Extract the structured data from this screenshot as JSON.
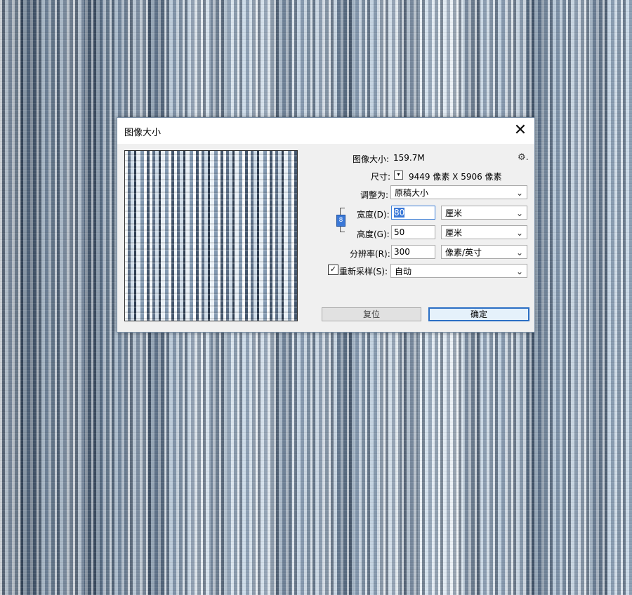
{
  "dialog": {
    "title": "图像大小",
    "close_glyph": "✕",
    "image_size_label": "图像大小:",
    "image_size_value": "159.7M",
    "gear_glyph": "⚙.",
    "dimensions_label": "尺寸:",
    "dimensions_dropdown_glyph": "▾",
    "dimensions_value": "9449 像素  X  5906 像素",
    "fit_to_label": "调整为:",
    "fit_to_value": "原稿大小",
    "width_label": "宽度(D):",
    "width_value": "80",
    "width_unit": "厘米",
    "height_label": "高度(G):",
    "height_value": "50",
    "height_unit": "厘米",
    "resolution_label": "分辨率(R):",
    "resolution_value": "300",
    "resolution_unit": "像素/英寸",
    "resample_checked": true,
    "resample_check_glyph": "✓",
    "resample_label": "重新采样(S):",
    "resample_value": "自动",
    "link_glyph": "8",
    "arrow_glyph": "⌄",
    "reset_button": "复位",
    "ok_button": "确定"
  }
}
